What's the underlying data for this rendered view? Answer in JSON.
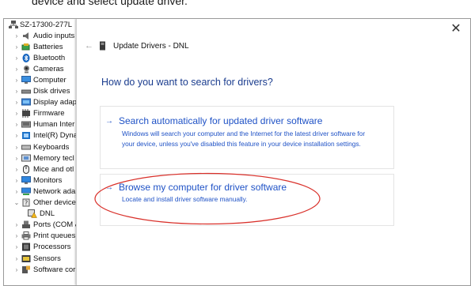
{
  "caption": "device and select update driver.",
  "device_tree": {
    "root": {
      "label": "SZ-17300-277L",
      "icon": "computer-network-icon"
    },
    "items": [
      {
        "label": "Audio inputs",
        "icon": "speaker-icon",
        "expanded": false
      },
      {
        "label": "Batteries",
        "icon": "battery-icon",
        "expanded": false
      },
      {
        "label": "Bluetooth",
        "icon": "bluetooth-icon",
        "expanded": false
      },
      {
        "label": "Cameras",
        "icon": "camera-icon",
        "expanded": false
      },
      {
        "label": "Computer",
        "icon": "monitor-icon",
        "expanded": false
      },
      {
        "label": "Disk drives",
        "icon": "disk-drive-icon",
        "expanded": false
      },
      {
        "label": "Display adap",
        "icon": "display-adapter-icon",
        "expanded": false
      },
      {
        "label": "Firmware",
        "icon": "firmware-icon",
        "expanded": false
      },
      {
        "label": "Human Inter",
        "icon": "hid-icon",
        "expanded": false
      },
      {
        "label": "Intel(R) Dyna",
        "icon": "intel-icon",
        "expanded": false
      },
      {
        "label": "Keyboards",
        "icon": "keyboard-icon",
        "expanded": false
      },
      {
        "label": "Memory tecl",
        "icon": "memory-icon",
        "expanded": false
      },
      {
        "label": "Mice and otl",
        "icon": "mouse-icon",
        "expanded": false
      },
      {
        "label": "Monitors",
        "icon": "monitor-icon",
        "expanded": false
      },
      {
        "label": "Network ada",
        "icon": "network-adapter-icon",
        "expanded": false
      },
      {
        "label": "Other device",
        "icon": "unknown-device-icon",
        "expanded": true
      },
      {
        "label": "DNL",
        "icon": "warning-device-icon",
        "child": true
      },
      {
        "label": "Ports (COM &",
        "icon": "port-icon",
        "expanded": false
      },
      {
        "label": "Print queues",
        "icon": "printer-icon",
        "expanded": false
      },
      {
        "label": "Processors",
        "icon": "processor-icon",
        "expanded": false
      },
      {
        "label": "Sensors",
        "icon": "sensor-icon",
        "expanded": false
      },
      {
        "label": "Software cor",
        "icon": "software-component-icon",
        "expanded": false
      }
    ]
  },
  "dialog": {
    "title": "Update Drivers - DNL",
    "close_glyph": "✕",
    "back_glyph": "←",
    "heading": "How do you want to search for drivers?",
    "options": [
      {
        "arrow": "→",
        "title": "Search automatically for updated driver software",
        "description_line1": "Windows will search your computer and the Internet for the latest driver software for",
        "description_line2": "your device, unless you've disabled this feature in your device installation settings."
      },
      {
        "arrow": "→",
        "title": "Browse my computer for driver software",
        "description_line1": "Locate and install driver software manually."
      }
    ]
  },
  "colors": {
    "link_blue": "#1f52c6",
    "heading_blue": "#1a3c8e",
    "annotation_red": "#d9302a"
  }
}
